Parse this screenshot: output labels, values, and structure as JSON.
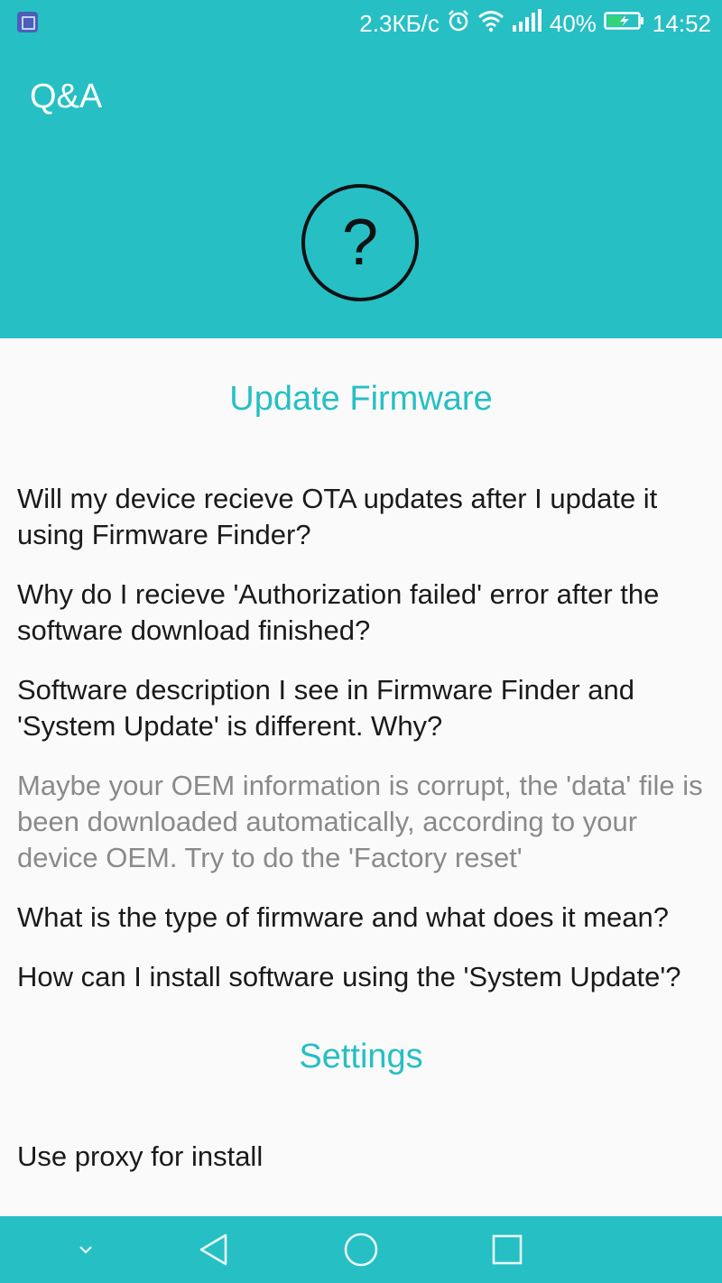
{
  "status_bar": {
    "speed": "2.3КБ/с",
    "battery": "40%",
    "time": "14:52"
  },
  "header": {
    "title": "Q&A",
    "icon": "question-circle-icon",
    "icon_glyph": "?",
    "background_color": "#26bfc4"
  },
  "sections": [
    {
      "title": "Update Firmware",
      "items": [
        {
          "text": "Will my device recieve OTA updates after I update it using Firmware Finder?"
        },
        {
          "text": "Why do I recieve 'Authorization failed' error after the software download finished?"
        },
        {
          "text": "Software description I see in Firmware Finder and 'System Update' is different. Why?"
        },
        {
          "text": "Maybe your OEM information is corrupt, the 'data' file is been downloaded automatically, according to your device OEM. Try to do the 'Factory reset'"
        },
        {
          "text": "What is the type of firmware and what does it mean?"
        },
        {
          "text": "How can I install software using the 'System Update'?"
        }
      ]
    },
    {
      "title": "Settings",
      "items": [
        {
          "text": "Use proxy for install"
        }
      ]
    }
  ],
  "navbar": {
    "buttons": [
      "chevron-down-icon",
      "back-icon",
      "home-icon",
      "recents-icon"
    ]
  }
}
